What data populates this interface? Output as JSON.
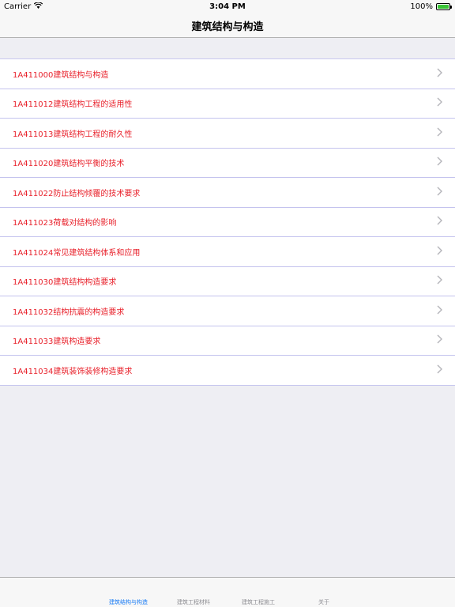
{
  "status": {
    "carrier": "Carrier",
    "time": "3:04 PM",
    "battery_text": "100%",
    "battery_level": 1.0
  },
  "nav": {
    "title": "建筑结构与构造"
  },
  "list": {
    "items": [
      {
        "label": "1A411000建筑结构与构造"
      },
      {
        "label": "1A411012建筑结构工程的适用性"
      },
      {
        "label": "1A411013建筑结构工程的耐久性"
      },
      {
        "label": "1A411020建筑结构平衡的技术"
      },
      {
        "label": "1A411022防止结构倾覆的技术要求"
      },
      {
        "label": "1A411023荷载对结构的影响"
      },
      {
        "label": "1A411024常见建筑结构体系和应用"
      },
      {
        "label": "1A411030建筑结构构造要求"
      },
      {
        "label": "1A411032结构抗震的构造要求"
      },
      {
        "label": "1A411033建筑构造要求"
      },
      {
        "label": "1A411034建筑装饰装修构造要求"
      }
    ],
    "text_color": "#e8202a"
  },
  "tabs": [
    {
      "label": "建筑结构与构造",
      "active": true
    },
    {
      "label": "建筑工程材料",
      "active": false
    },
    {
      "label": "建筑工程施工",
      "active": false
    },
    {
      "label": "关于",
      "active": false
    }
  ],
  "colors": {
    "active_tab": "#1a7cf5",
    "inactive_tab": "#8e8e93",
    "battery": "#3ac437"
  }
}
